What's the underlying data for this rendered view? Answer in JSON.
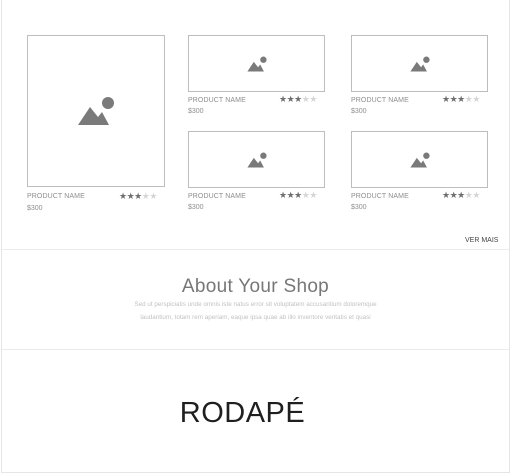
{
  "products": [
    {
      "name": "PRODUCT NAME",
      "price": "$300",
      "rating": 3,
      "max_rating": 5
    },
    {
      "name": "PRODUCT NAME",
      "price": "$300",
      "rating": 3,
      "max_rating": 5
    },
    {
      "name": "PRODUCT NAME",
      "price": "$300",
      "rating": 3,
      "max_rating": 5
    },
    {
      "name": "PRODUCT NAME",
      "price": "$300",
      "rating": 3,
      "max_rating": 5
    },
    {
      "name": "PRODUCT NAME",
      "price": "$300",
      "rating": 3,
      "max_rating": 5
    }
  ],
  "see_more_label": "VER MAIS",
  "about": {
    "title": "About Your Shop",
    "line1": "Sed ut perspiciatis unde omnis iste natus error sit voluptatem accusantium doloremque",
    "line2": "laudantium, totam rem aperiam, eaque ipsa quae ab illo inventore veritatis et quasi"
  },
  "footer": {
    "label": "RODAPÉ"
  },
  "colors": {
    "placeholder_icon": "#7a7a7a",
    "star_filled": "#6f6f6f",
    "star_empty": "#d6d6d6"
  },
  "icons": {
    "product_image": "image-placeholder-icon",
    "rating": "star-icon"
  }
}
